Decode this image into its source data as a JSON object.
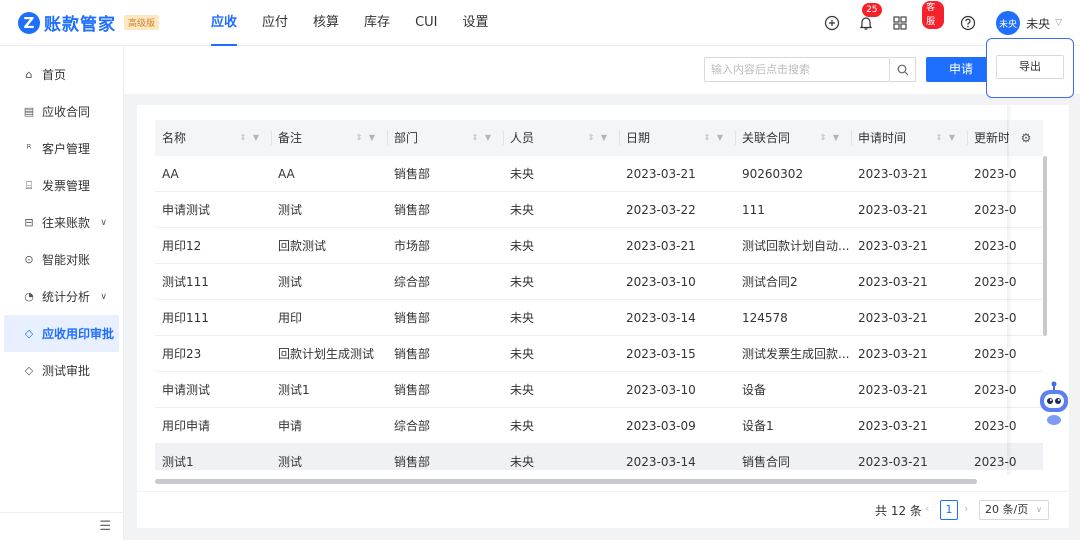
{
  "brand": {
    "logo_letter": "Z",
    "name": "账款管家",
    "tag": "高级版",
    "color": "#1f6fff"
  },
  "nav": [
    {
      "label": "应收",
      "active": true
    },
    {
      "label": "应付",
      "active": false
    },
    {
      "label": "核算",
      "active": false
    },
    {
      "label": "库存",
      "active": false
    },
    {
      "label": "CUI",
      "active": false
    },
    {
      "label": "设置",
      "active": false
    }
  ],
  "header_right": {
    "notification_count": "25",
    "service_badge": "客服",
    "avatar_text": "未央",
    "user_name": "未央"
  },
  "sidebar": {
    "items": [
      {
        "label": "首页",
        "icon": "home-icon",
        "glyph": "⌂",
        "expandable": false,
        "active": false
      },
      {
        "label": "应收合同",
        "icon": "contract-icon",
        "glyph": "▤",
        "expandable": false,
        "active": false
      },
      {
        "label": "客户管理",
        "icon": "customer-icon",
        "glyph": "ᴿ",
        "expandable": false,
        "active": false
      },
      {
        "label": "发票管理",
        "icon": "invoice-icon",
        "glyph": "⌸",
        "expandable": false,
        "active": false
      },
      {
        "label": "往来账款",
        "icon": "account-icon",
        "glyph": "⊟",
        "expandable": true,
        "active": false
      },
      {
        "label": "智能对账",
        "icon": "reconcile-icon",
        "glyph": "⊙",
        "expandable": false,
        "active": false
      },
      {
        "label": "统计分析",
        "icon": "statistics-icon",
        "glyph": "◔",
        "expandable": true,
        "active": false
      },
      {
        "label": "应收用印审批",
        "icon": "tag-icon",
        "glyph": "◇",
        "expandable": false,
        "active": true
      },
      {
        "label": "测试审批",
        "icon": "tag-icon",
        "glyph": "◇",
        "expandable": false,
        "active": false
      }
    ]
  },
  "toolbar": {
    "search_placeholder": "输入内容后点击搜索",
    "apply_label": "申请",
    "export_label": "导出"
  },
  "table": {
    "columns": [
      "名称",
      "备注",
      "部门",
      "人员",
      "日期",
      "关联合同",
      "申请时间",
      "更新时间"
    ],
    "rows": [
      [
        "AA",
        "AA",
        "销售部",
        "未央",
        "2023-03-21",
        "90260302",
        "2023-03-21",
        "2023-0"
      ],
      [
        "申请测试",
        "测试",
        "销售部",
        "未央",
        "2023-03-22",
        "111",
        "2023-03-21",
        "2023-0"
      ],
      [
        "用印12",
        "回款测试",
        "市场部",
        "未央",
        "2023-03-21",
        "测试回款计划自动...",
        "2023-03-21",
        "2023-0"
      ],
      [
        "测试111",
        "测试",
        "综合部",
        "未央",
        "2023-03-10",
        "测试合同2",
        "2023-03-21",
        "2023-0"
      ],
      [
        "用印111",
        "用印",
        "销售部",
        "未央",
        "2023-03-14",
        "124578",
        "2023-03-21",
        "2023-0"
      ],
      [
        "用印23",
        "回款计划生成测试",
        "销售部",
        "未央",
        "2023-03-15",
        "测试发票生成回款...",
        "2023-03-21",
        "2023-0"
      ],
      [
        "申请测试",
        "测试1",
        "销售部",
        "未央",
        "2023-03-10",
        "设备",
        "2023-03-21",
        "2023-0"
      ],
      [
        "用印申请",
        "申请",
        "综合部",
        "未央",
        "2023-03-09",
        "设备1",
        "2023-03-21",
        "2023-0"
      ],
      [
        "测试1",
        "测试",
        "销售部",
        "未央",
        "2023-03-14",
        "销售合同",
        "2023-03-21",
        "2023-0"
      ]
    ]
  },
  "pagination": {
    "total": "共 12 条",
    "current_page": "1",
    "page_size": "20 条/页"
  }
}
